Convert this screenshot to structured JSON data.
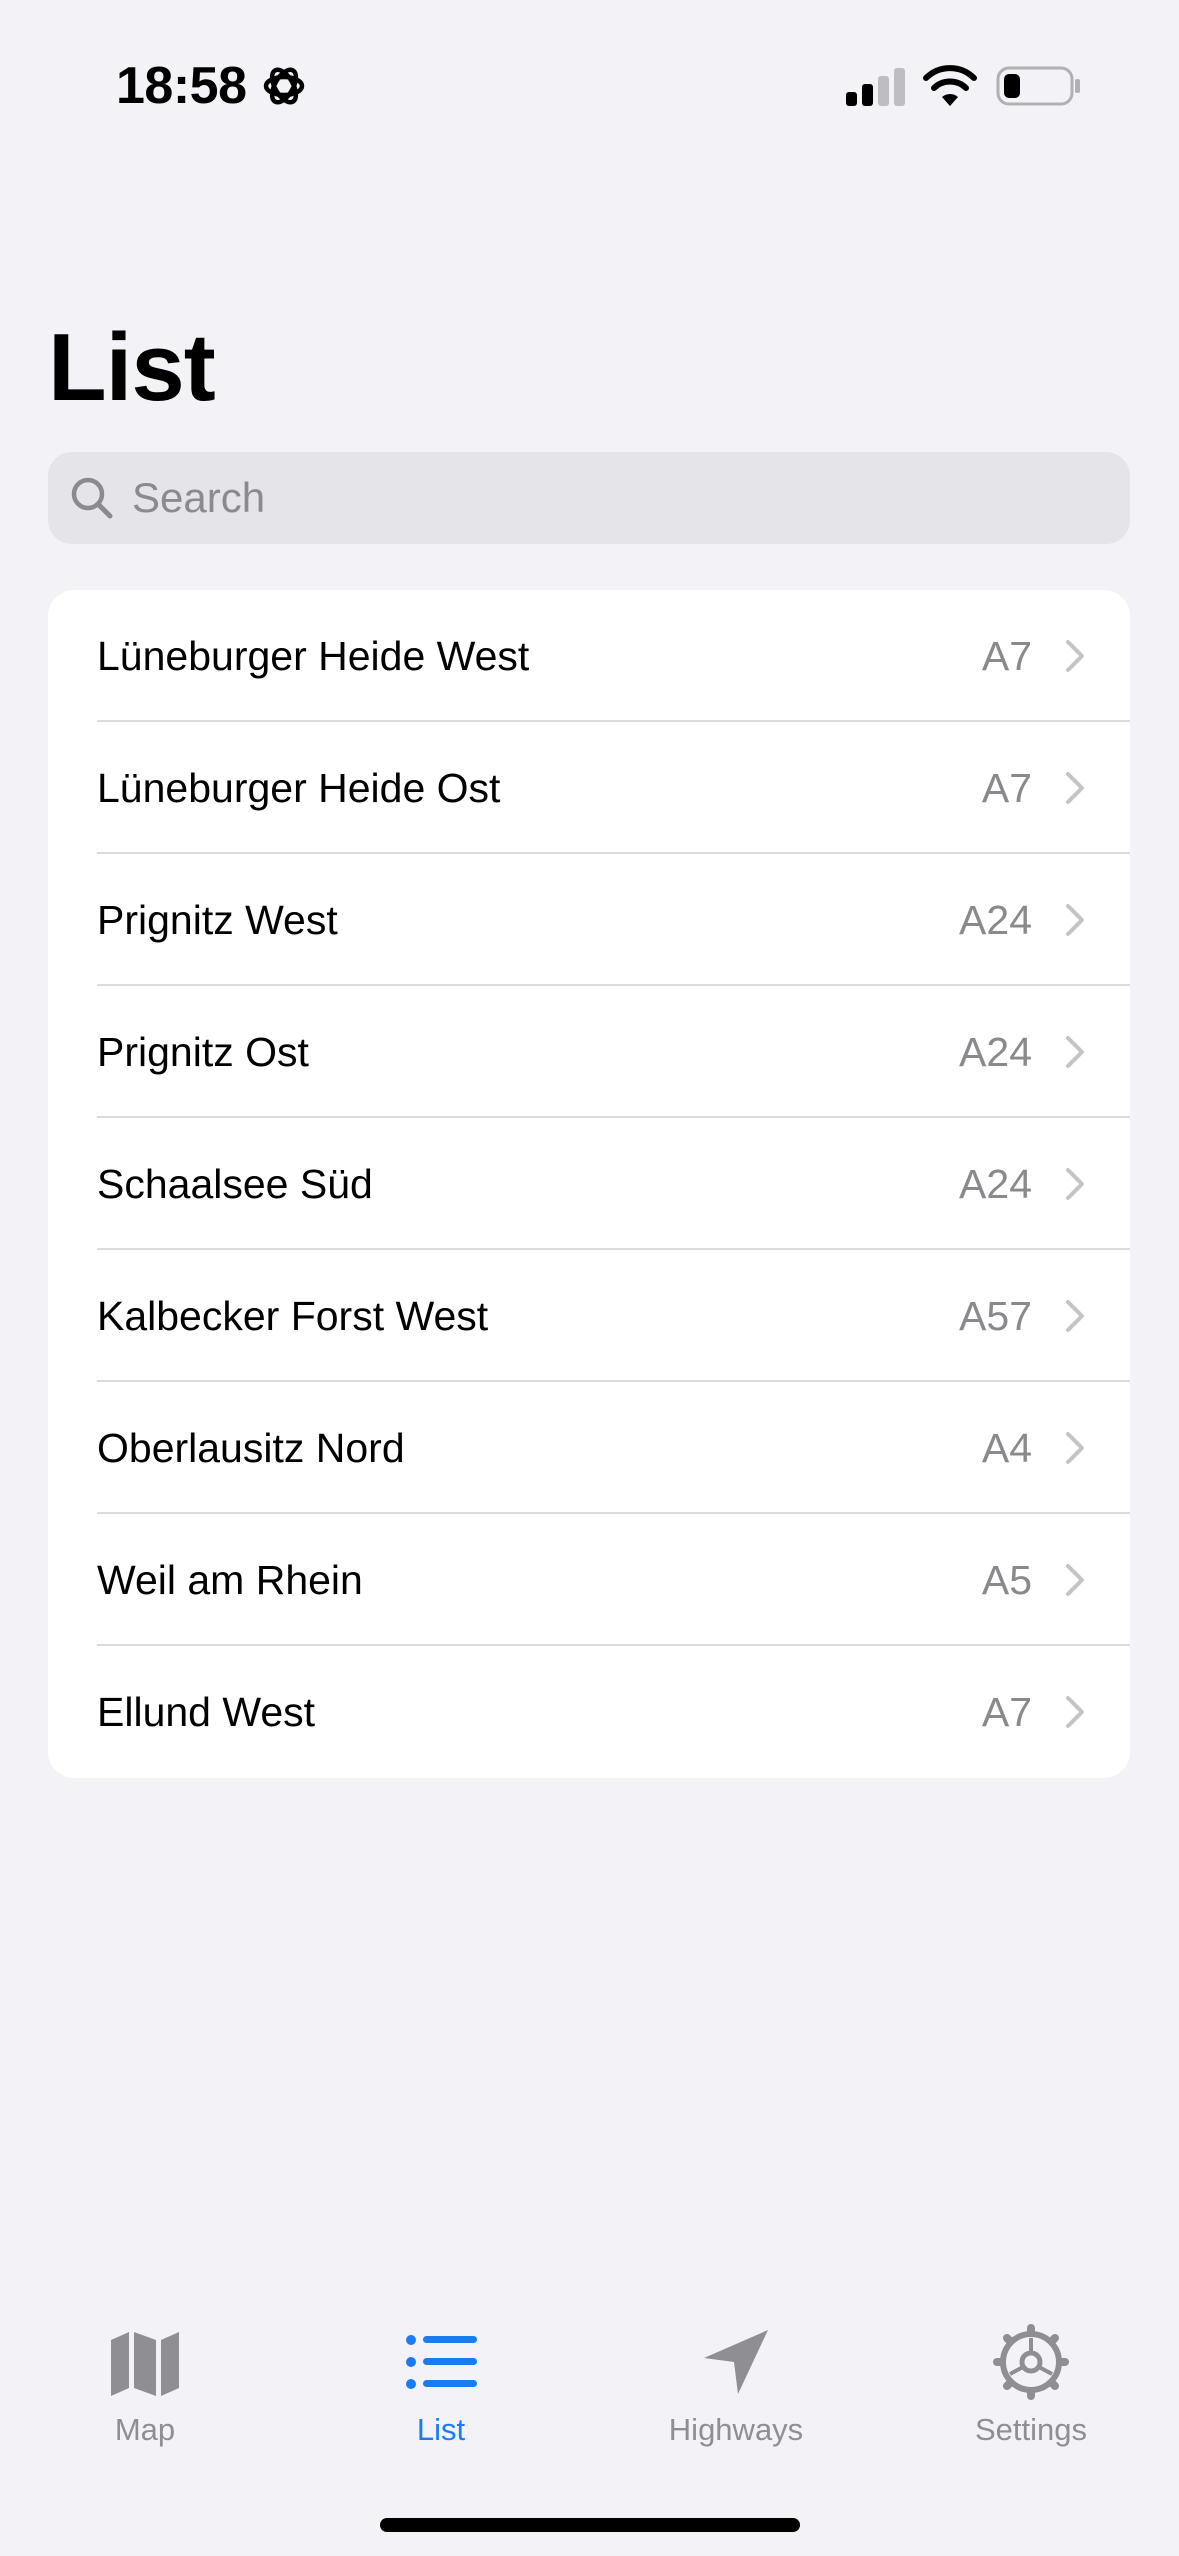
{
  "status_bar": {
    "time": "18:58"
  },
  "page": {
    "title": "List"
  },
  "search": {
    "placeholder": "Search"
  },
  "list": {
    "items": [
      {
        "name": "Lüneburger Heide West",
        "road": "A7"
      },
      {
        "name": "Lüneburger Heide Ost",
        "road": "A7"
      },
      {
        "name": "Prignitz West",
        "road": "A24"
      },
      {
        "name": "Prignitz Ost",
        "road": "A24"
      },
      {
        "name": "Schaalsee Süd",
        "road": "A24"
      },
      {
        "name": "Kalbecker Forst West",
        "road": "A57"
      },
      {
        "name": "Oberlausitz Nord",
        "road": "A4"
      },
      {
        "name": "Weil am Rhein",
        "road": "A5"
      },
      {
        "name": "Ellund West",
        "road": "A7"
      }
    ]
  },
  "tab_bar": {
    "tabs": [
      {
        "label": "Map",
        "icon": "map-icon",
        "active": false
      },
      {
        "label": "List",
        "icon": "list-icon",
        "active": true
      },
      {
        "label": "Highways",
        "icon": "location-arrow-icon",
        "active": false
      },
      {
        "label": "Settings",
        "icon": "gear-icon",
        "active": false
      }
    ]
  },
  "colors": {
    "accent": "#1a7cf4",
    "background": "#f2f2f7",
    "secondary_text": "#8a8a8e"
  }
}
